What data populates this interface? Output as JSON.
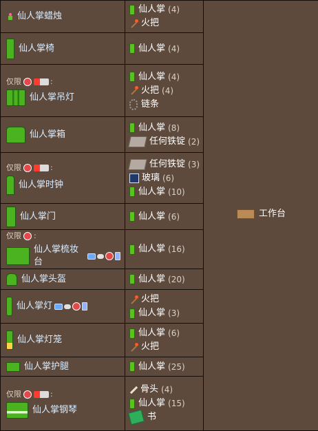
{
  "items": {
    "water_candle": "仙人掌蜡烛",
    "chair": "仙人掌椅",
    "chandelier": "仙人掌吊灯",
    "chest": "仙人掌箱",
    "clock": "仙人掌时钟",
    "door": "仙人掌门",
    "dresser": "仙人掌梳妆台",
    "helmet": "仙人掌头盔",
    "lamp": "仙人掌灯",
    "lantern": "仙人掌灯笼",
    "greaves": "仙人掌护腿",
    "piano": "仙人掌钢琴"
  },
  "restrictions": {
    "only_label": "仅限",
    "colon": ":"
  },
  "ingredients": {
    "cactus": "仙人掌",
    "torch": "火把",
    "chain": "链条",
    "iron_bar": "任何铁锭",
    "glass": "玻璃",
    "bone": "骨头",
    "book": "书"
  },
  "quantities": {
    "q4": "(4)",
    "q8": "(8)",
    "q2": "(2)",
    "q3": "(3)",
    "q6": "(6)",
    "q10": "(10)",
    "q16": "(16)",
    "q20": "(20)",
    "q25": "(25)",
    "q15": "(15)"
  },
  "station": {
    "name": "工作台"
  },
  "icons": {
    "cactus": "cactus-block-icon",
    "torch": "torch-icon",
    "chain": "chain-icon",
    "iron": "iron-bar-icon",
    "glass": "glass-icon",
    "bone": "bone-icon",
    "book": "book-icon",
    "workbench": "workbench-icon",
    "platform_restriction": "3ds-icon"
  },
  "colors": {
    "background": "#5e4a3c",
    "border": "#120d09",
    "item_name": "#d8ecff",
    "text": "#ffffff"
  }
}
